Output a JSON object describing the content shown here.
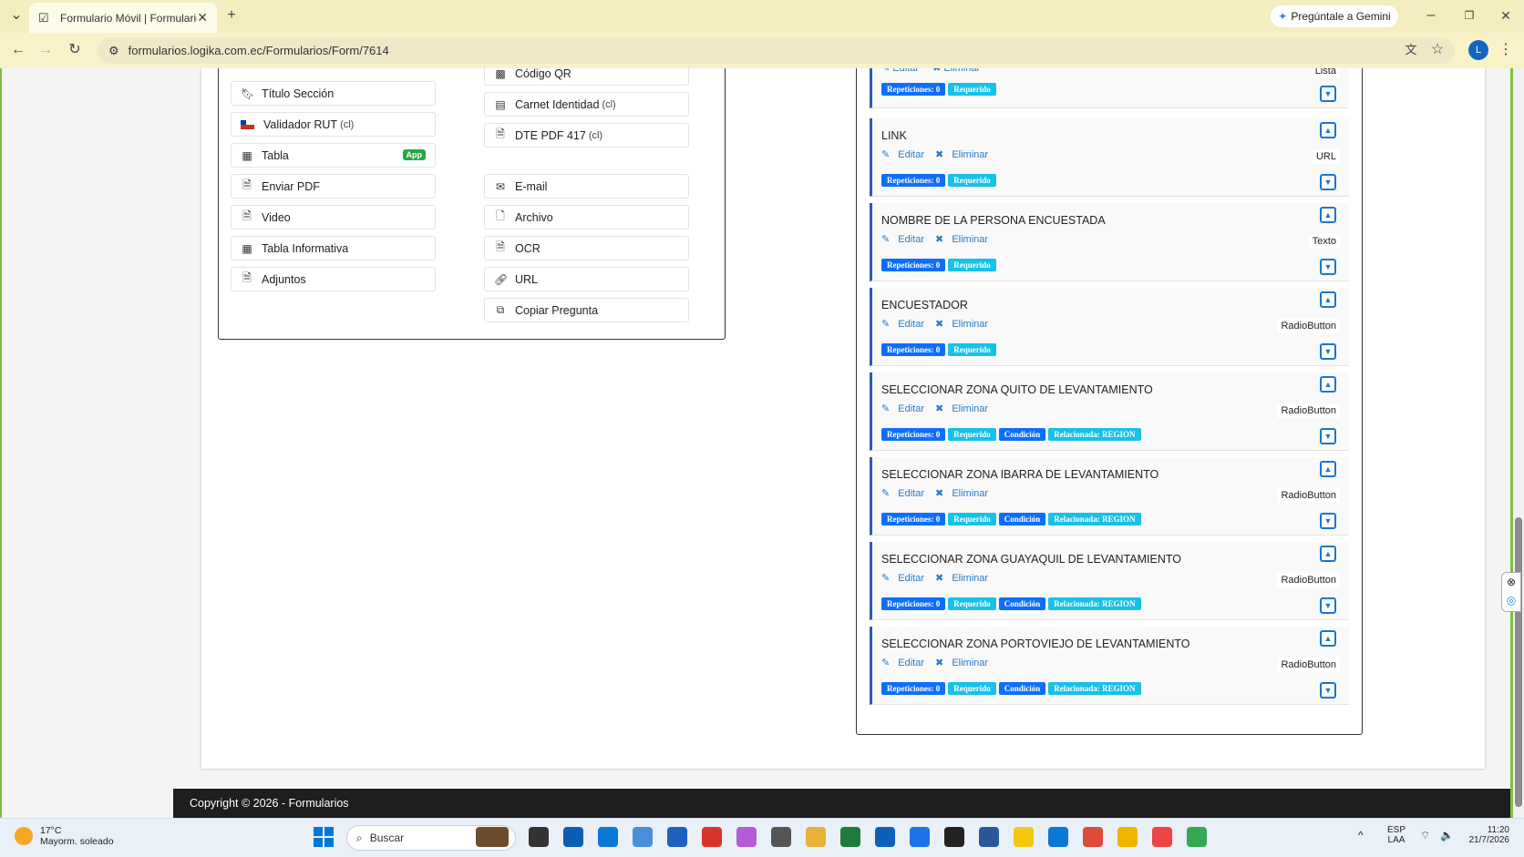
{
  "browser": {
    "tab_title": "Formulario Móvil | Formulario",
    "url": "formularios.logika.com.ec/Formularios/Form/7614",
    "gemini_label": "Pregúntale a Gemini",
    "profile_initial": "L"
  },
  "tools": {
    "left": [
      {
        "label": "Título Sección",
        "icon": "bookmark-icon"
      },
      {
        "label": "Validador RUT",
        "suffix": "(cl)",
        "icon": "chile-flag-icon"
      },
      {
        "label": "Tabla",
        "icon": "table-icon",
        "badge": "App"
      },
      {
        "label": "Enviar PDF",
        "icon": "pdf-icon"
      },
      {
        "label": "Video",
        "icon": "video-file-icon"
      },
      {
        "label": "Tabla Informativa",
        "icon": "table-icon"
      },
      {
        "label": "Adjuntos",
        "icon": "attachment-icon"
      }
    ],
    "right": [
      {
        "label": "Código QR",
        "icon": "qr-icon"
      },
      {
        "label": "Carnet Identidad",
        "suffix": "(cl)",
        "icon": "id-card-icon"
      },
      {
        "label": "DTE PDF 417",
        "suffix": "(cl)",
        "icon": "pdf-icon"
      },
      {
        "label": "E-mail",
        "icon": "envelope-icon"
      },
      {
        "label": "Archivo",
        "icon": "file-icon"
      },
      {
        "label": "OCR",
        "icon": "ocr-icon"
      },
      {
        "label": "URL",
        "icon": "link-icon"
      },
      {
        "label": "Copiar Pregunta",
        "icon": "copy-icon"
      }
    ]
  },
  "actions": {
    "edit": "Editar",
    "delete": "Eliminar"
  },
  "badges": {
    "rep": "Repeticiones: 0",
    "req": "Requerido",
    "cond": "Condición",
    "rel": "Relacionada: REGION"
  },
  "partial_question": {
    "type": "Lista"
  },
  "questions": [
    {
      "title": "LINK",
      "type": "URL",
      "cond": false
    },
    {
      "title": "NOMBRE DE LA PERSONA ENCUESTADA",
      "type": "Texto",
      "cond": false
    },
    {
      "title": "ENCUESTADOR",
      "type": "RadioButton",
      "cond": false
    },
    {
      "title": "SELECCIONAR ZONA QUITO DE LEVANTAMIENTO",
      "type": "RadioButton",
      "cond": true
    },
    {
      "title": "SELECCIONAR ZONA IBARRA DE LEVANTAMIENTO",
      "type": "RadioButton",
      "cond": true
    },
    {
      "title": "SELECCIONAR ZONA GUAYAQUIL DE LEVANTAMIENTO",
      "type": "RadioButton",
      "cond": true
    },
    {
      "title": "SELECCIONAR ZONA PORTOVIEJO DE LEVANTAMIENTO",
      "type": "RadioButton",
      "cond": true
    }
  ],
  "footer": {
    "text": "Copyright © 2026 - Formularios"
  },
  "taskbar": {
    "temp": "17°C",
    "weather": "Mayorm. soleado",
    "search": "Buscar",
    "lang1": "ESP",
    "lang2": "LAA",
    "time": "11:20",
    "date": "21/7/2026"
  }
}
